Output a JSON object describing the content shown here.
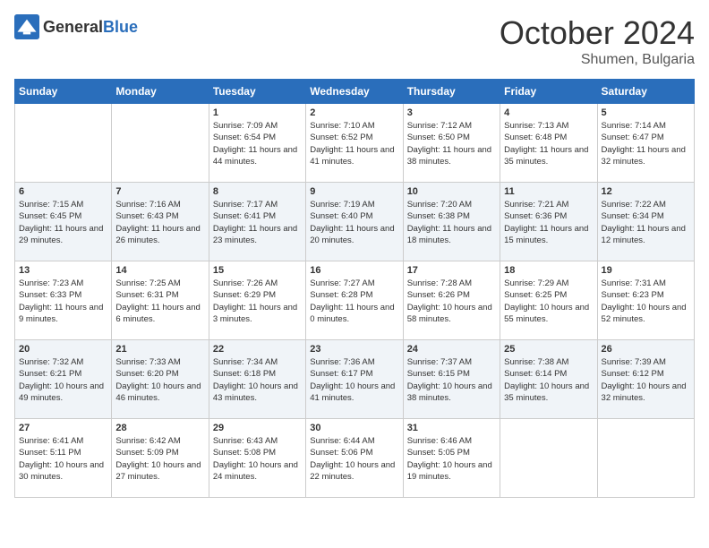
{
  "header": {
    "logo_general": "General",
    "logo_blue": "Blue",
    "month": "October 2024",
    "location": "Shumen, Bulgaria"
  },
  "weekdays": [
    "Sunday",
    "Monday",
    "Tuesday",
    "Wednesday",
    "Thursday",
    "Friday",
    "Saturday"
  ],
  "weeks": [
    [
      null,
      null,
      {
        "day": "1",
        "sunrise": "Sunrise: 7:09 AM",
        "sunset": "Sunset: 6:54 PM",
        "daylight": "Daylight: 11 hours and 44 minutes."
      },
      {
        "day": "2",
        "sunrise": "Sunrise: 7:10 AM",
        "sunset": "Sunset: 6:52 PM",
        "daylight": "Daylight: 11 hours and 41 minutes."
      },
      {
        "day": "3",
        "sunrise": "Sunrise: 7:12 AM",
        "sunset": "Sunset: 6:50 PM",
        "daylight": "Daylight: 11 hours and 38 minutes."
      },
      {
        "day": "4",
        "sunrise": "Sunrise: 7:13 AM",
        "sunset": "Sunset: 6:48 PM",
        "daylight": "Daylight: 11 hours and 35 minutes."
      },
      {
        "day": "5",
        "sunrise": "Sunrise: 7:14 AM",
        "sunset": "Sunset: 6:47 PM",
        "daylight": "Daylight: 11 hours and 32 minutes."
      }
    ],
    [
      {
        "day": "6",
        "sunrise": "Sunrise: 7:15 AM",
        "sunset": "Sunset: 6:45 PM",
        "daylight": "Daylight: 11 hours and 29 minutes."
      },
      {
        "day": "7",
        "sunrise": "Sunrise: 7:16 AM",
        "sunset": "Sunset: 6:43 PM",
        "daylight": "Daylight: 11 hours and 26 minutes."
      },
      {
        "day": "8",
        "sunrise": "Sunrise: 7:17 AM",
        "sunset": "Sunset: 6:41 PM",
        "daylight": "Daylight: 11 hours and 23 minutes."
      },
      {
        "day": "9",
        "sunrise": "Sunrise: 7:19 AM",
        "sunset": "Sunset: 6:40 PM",
        "daylight": "Daylight: 11 hours and 20 minutes."
      },
      {
        "day": "10",
        "sunrise": "Sunrise: 7:20 AM",
        "sunset": "Sunset: 6:38 PM",
        "daylight": "Daylight: 11 hours and 18 minutes."
      },
      {
        "day": "11",
        "sunrise": "Sunrise: 7:21 AM",
        "sunset": "Sunset: 6:36 PM",
        "daylight": "Daylight: 11 hours and 15 minutes."
      },
      {
        "day": "12",
        "sunrise": "Sunrise: 7:22 AM",
        "sunset": "Sunset: 6:34 PM",
        "daylight": "Daylight: 11 hours and 12 minutes."
      }
    ],
    [
      {
        "day": "13",
        "sunrise": "Sunrise: 7:23 AM",
        "sunset": "Sunset: 6:33 PM",
        "daylight": "Daylight: 11 hours and 9 minutes."
      },
      {
        "day": "14",
        "sunrise": "Sunrise: 7:25 AM",
        "sunset": "Sunset: 6:31 PM",
        "daylight": "Daylight: 11 hours and 6 minutes."
      },
      {
        "day": "15",
        "sunrise": "Sunrise: 7:26 AM",
        "sunset": "Sunset: 6:29 PM",
        "daylight": "Daylight: 11 hours and 3 minutes."
      },
      {
        "day": "16",
        "sunrise": "Sunrise: 7:27 AM",
        "sunset": "Sunset: 6:28 PM",
        "daylight": "Daylight: 11 hours and 0 minutes."
      },
      {
        "day": "17",
        "sunrise": "Sunrise: 7:28 AM",
        "sunset": "Sunset: 6:26 PM",
        "daylight": "Daylight: 10 hours and 58 minutes."
      },
      {
        "day": "18",
        "sunrise": "Sunrise: 7:29 AM",
        "sunset": "Sunset: 6:25 PM",
        "daylight": "Daylight: 10 hours and 55 minutes."
      },
      {
        "day": "19",
        "sunrise": "Sunrise: 7:31 AM",
        "sunset": "Sunset: 6:23 PM",
        "daylight": "Daylight: 10 hours and 52 minutes."
      }
    ],
    [
      {
        "day": "20",
        "sunrise": "Sunrise: 7:32 AM",
        "sunset": "Sunset: 6:21 PM",
        "daylight": "Daylight: 10 hours and 49 minutes."
      },
      {
        "day": "21",
        "sunrise": "Sunrise: 7:33 AM",
        "sunset": "Sunset: 6:20 PM",
        "daylight": "Daylight: 10 hours and 46 minutes."
      },
      {
        "day": "22",
        "sunrise": "Sunrise: 7:34 AM",
        "sunset": "Sunset: 6:18 PM",
        "daylight": "Daylight: 10 hours and 43 minutes."
      },
      {
        "day": "23",
        "sunrise": "Sunrise: 7:36 AM",
        "sunset": "Sunset: 6:17 PM",
        "daylight": "Daylight: 10 hours and 41 minutes."
      },
      {
        "day": "24",
        "sunrise": "Sunrise: 7:37 AM",
        "sunset": "Sunset: 6:15 PM",
        "daylight": "Daylight: 10 hours and 38 minutes."
      },
      {
        "day": "25",
        "sunrise": "Sunrise: 7:38 AM",
        "sunset": "Sunset: 6:14 PM",
        "daylight": "Daylight: 10 hours and 35 minutes."
      },
      {
        "day": "26",
        "sunrise": "Sunrise: 7:39 AM",
        "sunset": "Sunset: 6:12 PM",
        "daylight": "Daylight: 10 hours and 32 minutes."
      }
    ],
    [
      {
        "day": "27",
        "sunrise": "Sunrise: 6:41 AM",
        "sunset": "Sunset: 5:11 PM",
        "daylight": "Daylight: 10 hours and 30 minutes."
      },
      {
        "day": "28",
        "sunrise": "Sunrise: 6:42 AM",
        "sunset": "Sunset: 5:09 PM",
        "daylight": "Daylight: 10 hours and 27 minutes."
      },
      {
        "day": "29",
        "sunrise": "Sunrise: 6:43 AM",
        "sunset": "Sunset: 5:08 PM",
        "daylight": "Daylight: 10 hours and 24 minutes."
      },
      {
        "day": "30",
        "sunrise": "Sunrise: 6:44 AM",
        "sunset": "Sunset: 5:06 PM",
        "daylight": "Daylight: 10 hours and 22 minutes."
      },
      {
        "day": "31",
        "sunrise": "Sunrise: 6:46 AM",
        "sunset": "Sunset: 5:05 PM",
        "daylight": "Daylight: 10 hours and 19 minutes."
      },
      null,
      null
    ]
  ]
}
